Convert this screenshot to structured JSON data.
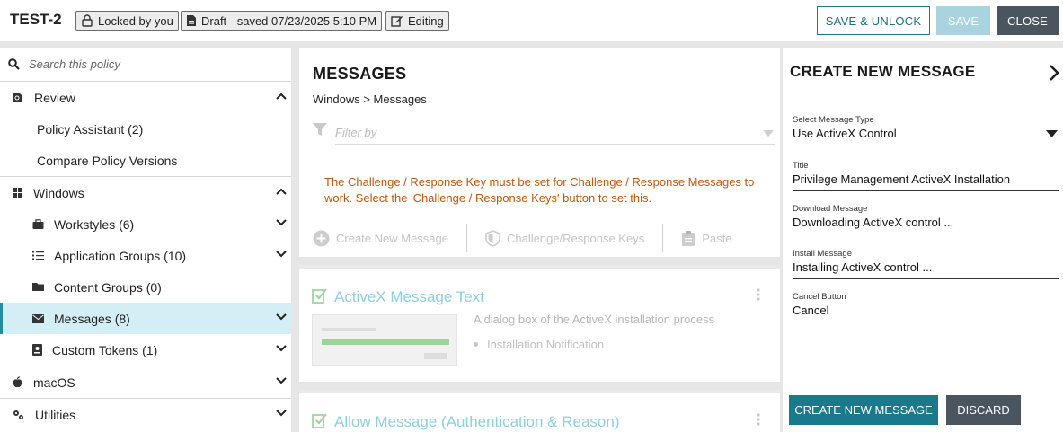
{
  "header": {
    "policy_name": "TEST-2",
    "locked_label": "Locked by you",
    "draft_label": "Draft - saved 07/23/2025 5:10 PM",
    "editing_label": "Editing",
    "save_unlock_label": "SAVE & UNLOCK",
    "save_label": "SAVE",
    "close_label": "CLOSE"
  },
  "sidebar": {
    "search_placeholder": "Search this policy",
    "review": {
      "label": "Review",
      "items": [
        "Policy Assistant (2)",
        "Compare Policy Versions"
      ]
    },
    "windows": {
      "label": "Windows",
      "items": [
        {
          "label": "Workstyles (6)",
          "icon": "briefcase-icon"
        },
        {
          "label": "Application Groups (10)",
          "icon": "list-icon"
        },
        {
          "label": "Content Groups (0)",
          "icon": "folder-icon"
        },
        {
          "label": "Messages (8)",
          "icon": "envelope-icon",
          "active": true
        },
        {
          "label": "Custom Tokens (1)",
          "icon": "token-icon"
        }
      ]
    },
    "macos_label": "macOS",
    "utilities_label": "Utilities"
  },
  "messages": {
    "title": "MESSAGES",
    "breadcrumb": "Windows > Messages",
    "filter_placeholder": "Filter by",
    "warning": "The Challenge / Response Key must be set for Challenge / Response Messages to work. Select the 'Challenge / Response Keys' button to set this.",
    "actions": {
      "create": "Create New Message",
      "keys": "Challenge/Response Keys",
      "paste": "Paste"
    },
    "cards": [
      {
        "title": "ActiveX Message Text",
        "description": "A dialog box of the ActiveX installation process",
        "bullet": "Installation Notification"
      },
      {
        "title": "Allow Message (Authentication & Reason)"
      }
    ]
  },
  "create_panel": {
    "title": "CREATE NEW MESSAGE",
    "fields": {
      "message_type": {
        "label": "Select Message Type",
        "value": "Use ActiveX Control"
      },
      "title": {
        "label": "Title",
        "value": "Privilege Management ActiveX Installation"
      },
      "download": {
        "label": "Download Message",
        "value": "Downloading ActiveX control ..."
      },
      "install": {
        "label": "Install Message",
        "value": "Installing ActiveX control ..."
      },
      "cancel": {
        "label": "Cancel Button",
        "value": "Cancel"
      }
    },
    "create_button": "CREATE NEW MESSAGE",
    "discard_button": "DISCARD"
  },
  "colors": {
    "accent": "#1a7a8c",
    "dark_button": "#4a5560",
    "disabled_button": "#a9d3de",
    "warning_text": "#c0560e",
    "active_nav_bg": "#d3eef4"
  }
}
